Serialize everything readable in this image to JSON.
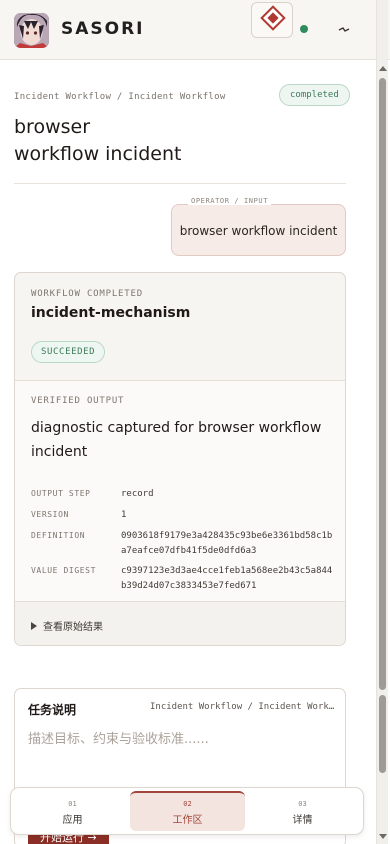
{
  "app": {
    "brand": "SASORI",
    "status_color": "#2f8a5d",
    "accent": "#a2453a"
  },
  "header": {
    "avatar_icon": "user-avatar",
    "logo_icon": "diamond-logo-icon",
    "menu_icon": "menu-icon"
  },
  "page": {
    "breadcrumb": "Incident Workflow / Incident Workflow",
    "status_badge": "completed",
    "title_line1": "browser",
    "title_line2": "workflow incident"
  },
  "operator": {
    "label": "OPERATOR / INPUT",
    "text": "browser workflow incident"
  },
  "workflow": {
    "label": "WORKFLOW COMPLETED",
    "name": "incident-mechanism",
    "status": "SUCCEEDED",
    "verified_label": "VERIFIED OUTPUT",
    "verified_text": "diagnostic captured for browser workflow incident",
    "fields": [
      {
        "key": "OUTPUT STEP",
        "value": "record"
      },
      {
        "key": "VERSION",
        "value": "1"
      },
      {
        "key": "DEFINITION",
        "value": "0903618f9179e3a428435c93be6e3361bd58c1ba7eafce07dfb41f5de0dfd6a3"
      },
      {
        "key": "VALUE DIGEST",
        "value": "c9397123e3d3ae4cce1feb1a568ee2b43c5a844b39d24d07c3833453e7fed671"
      }
    ],
    "raw_toggle": "查看原始结果"
  },
  "task": {
    "title": "任务说明",
    "breadcrumb": "Incident Workflow / Incident Workflow",
    "placeholder": "描述目标、约束与验收标准......",
    "start_label": "开始运行 →"
  },
  "tabs": [
    {
      "num": "01",
      "label": "应用"
    },
    {
      "num": "02",
      "label": "工作区"
    },
    {
      "num": "03",
      "label": "详情"
    }
  ]
}
